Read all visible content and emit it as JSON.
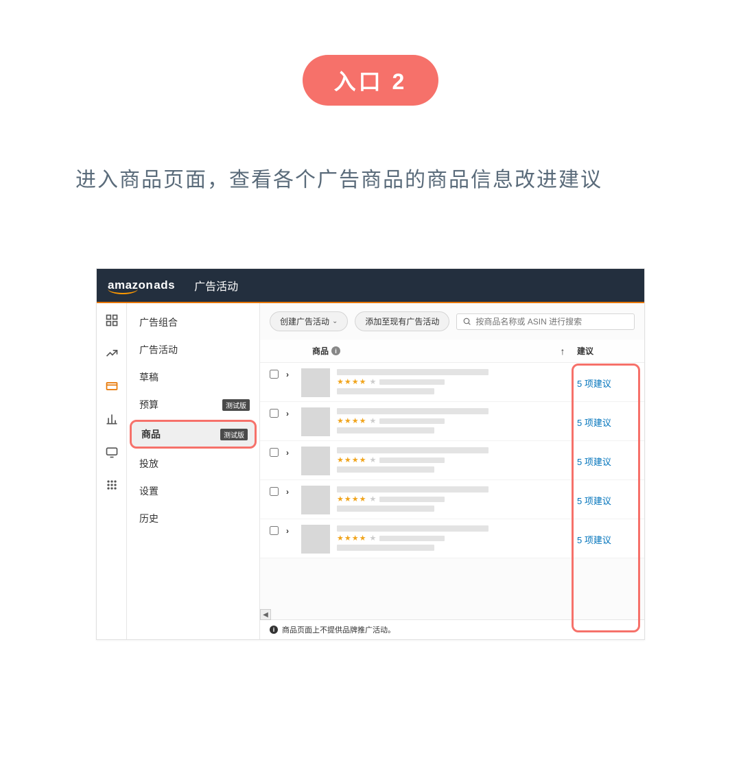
{
  "pill_label": "入口 2",
  "description": "进入商品页面，查看各个广告商品的商品信息改进建议",
  "topbar": {
    "brand_amazon": "amazon",
    "brand_ads": "ads",
    "title": "广告活动"
  },
  "nav": {
    "items": [
      {
        "label": "广告组合",
        "badge": ""
      },
      {
        "label": "广告活动",
        "badge": ""
      },
      {
        "label": "草稿",
        "badge": ""
      },
      {
        "label": "预算",
        "badge": "测试版"
      },
      {
        "label": "商品",
        "badge": "测试版",
        "active": true
      },
      {
        "label": "投放",
        "badge": ""
      },
      {
        "label": "设置",
        "badge": ""
      },
      {
        "label": "历史",
        "badge": ""
      }
    ]
  },
  "toolbar": {
    "create_label": "创建广告活动",
    "add_label": "添加至现有广告活动",
    "search_placeholder": "按商品名称或 ASIN 进行搜索"
  },
  "table": {
    "header_product": "商品",
    "header_suggestion": "建议",
    "sort_arrow": "↑",
    "rows": [
      {
        "suggestion": "5 项建议"
      },
      {
        "suggestion": "5 项建议"
      },
      {
        "suggestion": "5 项建议"
      },
      {
        "suggestion": "5 项建议"
      },
      {
        "suggestion": "5 项建议"
      }
    ]
  },
  "footer_note": "商品页面上不提供品牌推广活动。"
}
